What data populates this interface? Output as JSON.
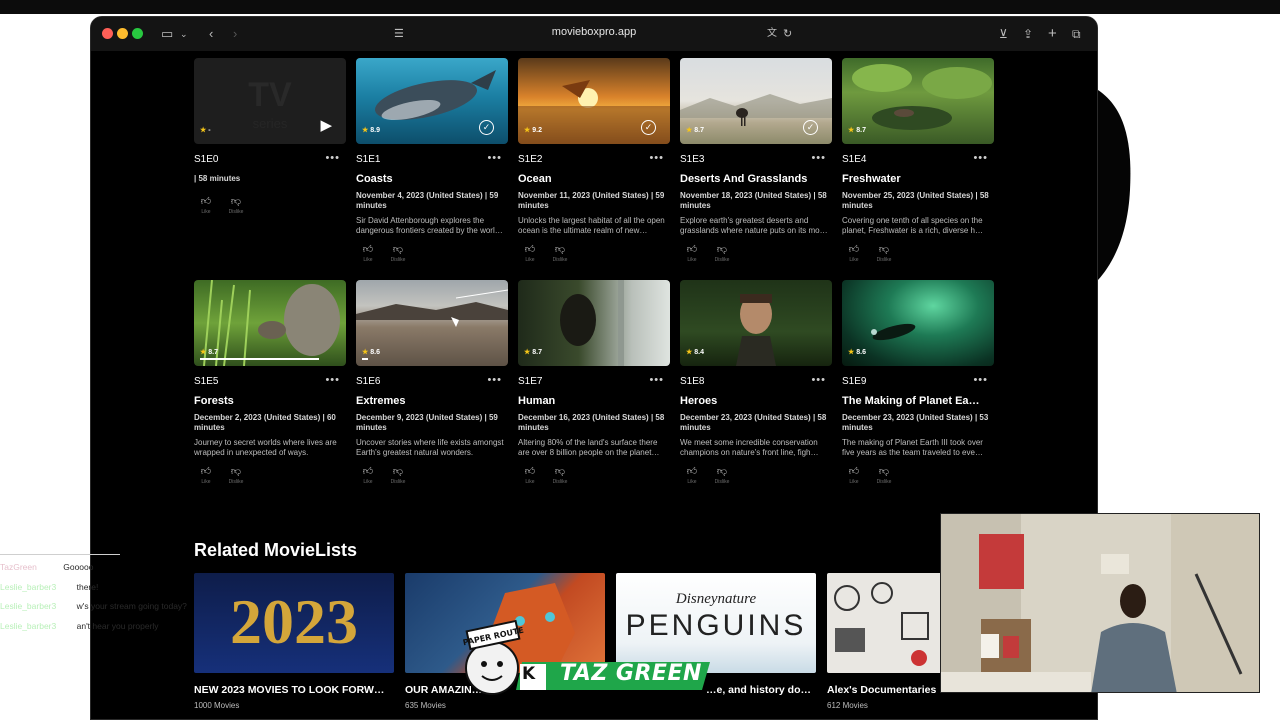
{
  "browser": {
    "url": "movieboxpro.app"
  },
  "episodes": [
    {
      "code": "S1E0",
      "title": "",
      "meta": "| 58 minutes",
      "desc": "",
      "rating": "-",
      "watched": false,
      "progress": 0
    },
    {
      "code": "S1E1",
      "title": "Coasts",
      "meta": "November 4, 2023 (United States) | 59 minutes",
      "desc": "Sir David Attenborough explores the dangerous frontiers created by the worl…",
      "rating": "8.9",
      "watched": true,
      "progress": 0
    },
    {
      "code": "S1E2",
      "title": "Ocean",
      "meta": "November 11, 2023 (United States) | 59 minutes",
      "desc": "Unlocks the largest habitat of all the open ocean is the ultimate realm of new…",
      "rating": "9.2",
      "watched": true,
      "progress": 0
    },
    {
      "code": "S1E3",
      "title": "Deserts And Grasslands",
      "meta": "November 18, 2023 (United States) | 58 minutes",
      "desc": "Explore earth's greatest deserts and grasslands where nature puts on its mo…",
      "rating": "8.7",
      "watched": true,
      "progress": 0
    },
    {
      "code": "S1E4",
      "title": "Freshwater",
      "meta": "November 25, 2023 (United States) | 58 minutes",
      "desc": "Covering one tenth of all species on the planet, Freshwater is a rich, diverse h…",
      "rating": "8.7",
      "watched": false,
      "progress": 0
    },
    {
      "code": "S1E5",
      "title": "Forests",
      "meta": "December 2, 2023 (United States) | 60 minutes",
      "desc": "Journey to secret worlds where lives are wrapped in unexpected of ways.",
      "rating": "8.7",
      "watched": false,
      "progress": 0.85
    },
    {
      "code": "S1E6",
      "title": "Extremes",
      "meta": "December 9, 2023 (United States) | 59 minutes",
      "desc": "Uncover stories where life exists amongst Earth's greatest natural wonders.",
      "rating": "8.6",
      "watched": false,
      "progress": 0.04
    },
    {
      "code": "S1E7",
      "title": "Human",
      "meta": "December 16, 2023 (United States) | 58 minutes",
      "desc": "Altering 80% of the land's surface there are over 8 billion people on the planet…",
      "rating": "8.7",
      "watched": false,
      "progress": 0
    },
    {
      "code": "S1E8",
      "title": "Heroes",
      "meta": "December 23, 2023 (United States) | 58 minutes",
      "desc": "We meet some incredible conservation champions on nature's front line, figh…",
      "rating": "8.4",
      "watched": false,
      "progress": 0
    },
    {
      "code": "S1E9",
      "title": "The Making of Planet Ea…",
      "meta": "December 23, 2023 (United States) | 53 minutes",
      "desc": "The making of Planet Earth III took over five years as the team traveled to eve…",
      "rating": "8.6",
      "watched": false,
      "progress": 0
    }
  ],
  "like_label": "Like",
  "dislike_label": "Dislike",
  "related": {
    "title": "Related MovieLists",
    "lists": [
      {
        "title": "NEW 2023 MOVIES TO LOOK FORW…",
        "count": "1000 Movies",
        "art": "2023"
      },
      {
        "title": "OUR AMAZIN…",
        "count": "635 Movies",
        "art": ""
      },
      {
        "title": "…e, and history doc…",
        "count": "",
        "art": "Disneynature PENGUINS"
      },
      {
        "title": "Alex's Documentaries",
        "count": "612 Movies",
        "art": ""
      }
    ]
  },
  "chat": [
    {
      "user": "TazGreen",
      "msg": "Gooooo"
    },
    {
      "user": "Leslie_barber3",
      "msg": "there!"
    },
    {
      "user": "Leslie_barber3",
      "msg": "w's your stream going today?"
    },
    {
      "user": "Leslie_barber3",
      "msg": "an't hear you properly"
    }
  ],
  "brand": {
    "name": "TAZ GREEN",
    "initial": "K",
    "badge": "PAPER ROUTE"
  }
}
